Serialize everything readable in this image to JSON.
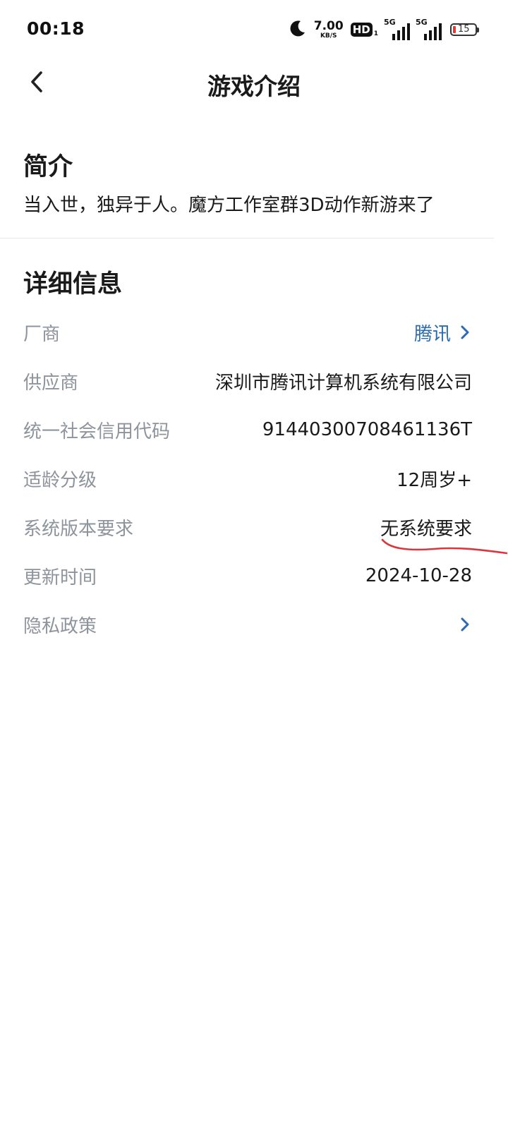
{
  "status_bar": {
    "time": "00:18",
    "net_speed_value": "7.00",
    "net_speed_unit": "KB/S",
    "hd_label": "HD",
    "hd_sub": "1",
    "signal_1_label": "5G",
    "signal_2_label": "5G",
    "battery_level": "15",
    "icons": [
      "moon-icon",
      "hd-icon",
      "signal-icon",
      "signal-icon",
      "battery-icon"
    ]
  },
  "nav": {
    "title": "游戏介绍",
    "back_icon": "chevron-left-icon"
  },
  "intro": {
    "heading": "简介",
    "text": "当入世，独异于人。魔方工作室群3D动作新游来了"
  },
  "details": {
    "heading": "详细信息",
    "rows": [
      {
        "label": "厂商",
        "value": "腾讯",
        "link": true
      },
      {
        "label": "供应商",
        "value": "深圳市腾讯计算机系统有限公司"
      },
      {
        "label": "统一社会信用代码",
        "value": "91440300708461136T"
      },
      {
        "label": "适龄分级",
        "value": "12周岁+"
      },
      {
        "label": "系统版本要求",
        "value": "无系统要求"
      },
      {
        "label": "更新时间",
        "value": "2024-10-28"
      },
      {
        "label": "隐私政策",
        "value": "",
        "link": true
      }
    ]
  },
  "colors": {
    "link": "#2a6bb0",
    "label": "#8e949c",
    "text": "#1a1a1a",
    "annotation": "#d9363e"
  }
}
